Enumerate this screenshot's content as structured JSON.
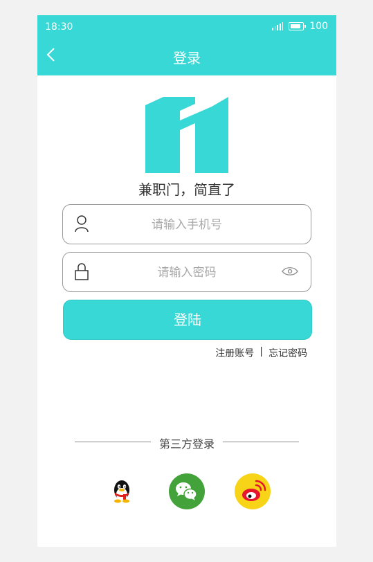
{
  "status_bar": {
    "time": "18:30",
    "battery": "100"
  },
  "header": {
    "title": "登录",
    "back_icon": "chevron-left-icon"
  },
  "brand": {
    "slogan": "兼职门，简直了",
    "logo_color": "#38d8d6"
  },
  "form": {
    "phone": {
      "placeholder": "请输入手机号",
      "icon": "user-icon"
    },
    "password": {
      "placeholder": "请输入密码",
      "icon": "lock-icon",
      "toggle_icon": "eye-icon"
    },
    "login_label": "登陆",
    "register_label": "注册账号",
    "separator": "|",
    "forgot_label": "忘记密码"
  },
  "third_party": {
    "title": "第三方登录",
    "providers": [
      {
        "icon": "qq-icon",
        "color": "#000000"
      },
      {
        "icon": "wechat-icon",
        "color": "#43a23a"
      },
      {
        "icon": "weibo-icon",
        "color": "#f7d417"
      }
    ]
  },
  "colors": {
    "accent": "#38d8d6",
    "background": "#f2f2f2",
    "card": "#ffffff"
  }
}
